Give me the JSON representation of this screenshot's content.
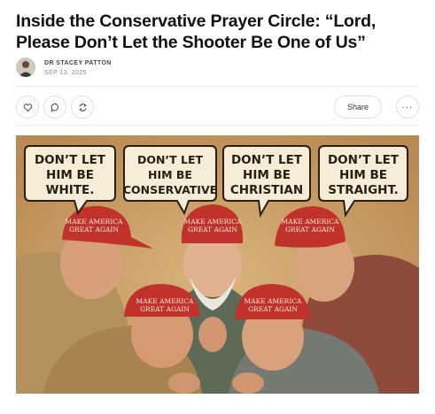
{
  "article": {
    "title": "Inside the Conservative Prayer Circle: “Lord, Please Don’t Let the Shooter Be One of Us”",
    "author": "DR STACEY PATTON",
    "date": "SEP 13, 2025"
  },
  "actions": {
    "like_icon": "heart-icon",
    "comment_icon": "comment-icon",
    "restack_icon": "restack-icon",
    "share_label": "Share",
    "more_label": "···"
  },
  "illustration": {
    "bubbles": [
      {
        "lines": [
          "DON’T LET",
          "HIM BE",
          "WHITE."
        ]
      },
      {
        "lines": [
          "DON’T LET",
          "HIM BE",
          "CONSERVATIVE"
        ]
      },
      {
        "lines": [
          "DON’T LET",
          "HIM BE",
          "CHRISTIAN"
        ]
      },
      {
        "lines": [
          "DON’T LET",
          "HIM BE",
          "STRAIGHT."
        ]
      }
    ],
    "hat_text": [
      "MAKE AMERICA",
      "GREAT AGAIN"
    ]
  },
  "colors": {
    "hat_red": "#c0322b",
    "background_tan": "#c9a06a",
    "bubble_fill": "#f6ecd8"
  }
}
